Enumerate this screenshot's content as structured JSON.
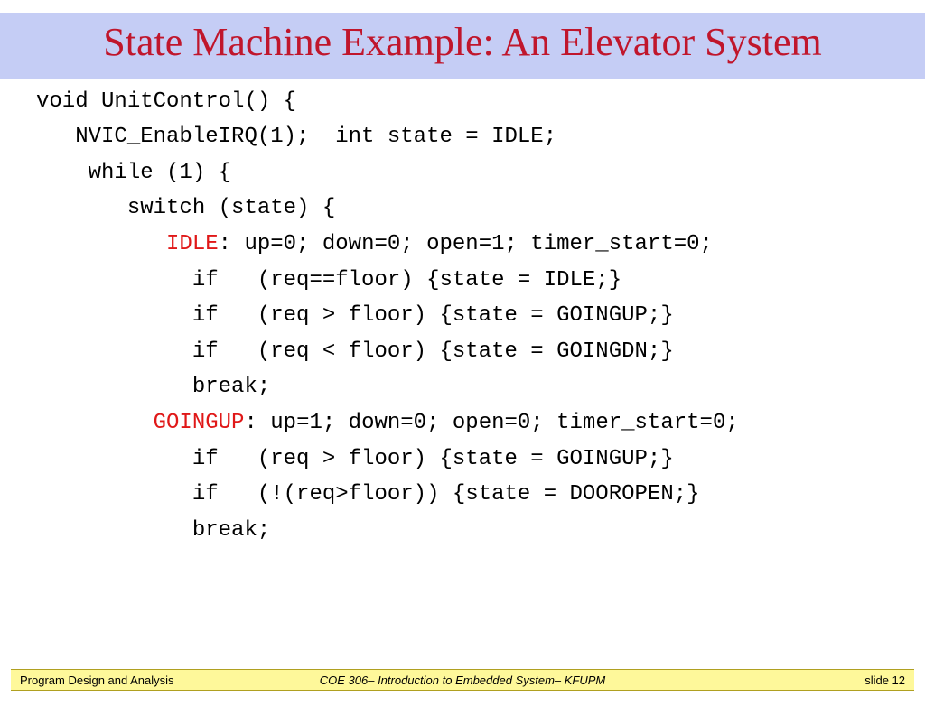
{
  "title": "State Machine Example: An Elevator System",
  "code": {
    "l1": "void UnitControl() {",
    "l2": "   NVIC_EnableIRQ(1);  int state = IDLE;",
    "l3": "    while (1) {",
    "l4": "       switch (state) {",
    "l5a": "          ",
    "l5kw": "IDLE",
    "l5b": ": up=0; down=0; open=1; timer_start=0;",
    "l6": "            if   (req==floor) {state = IDLE;}",
    "l7": "            if   (req > floor) {state = GOINGUP;}",
    "l8": "            if   (req < floor) {state = GOINGDN;}",
    "l9": "            break;",
    "l10a": "         ",
    "l10kw": "GOINGUP",
    "l10b": ": up=1; down=0; open=0; timer_start=0;",
    "l11": "            if   (req > floor) {state = GOINGUP;}",
    "l12": "            if   (!(req>floor)) {state = DOOROPEN;}",
    "l13": "            break;"
  },
  "footer": {
    "left": "Program Design and Analysis",
    "center": "COE 306– Introduction to Embedded System– KFUPM",
    "right": "slide 12"
  }
}
